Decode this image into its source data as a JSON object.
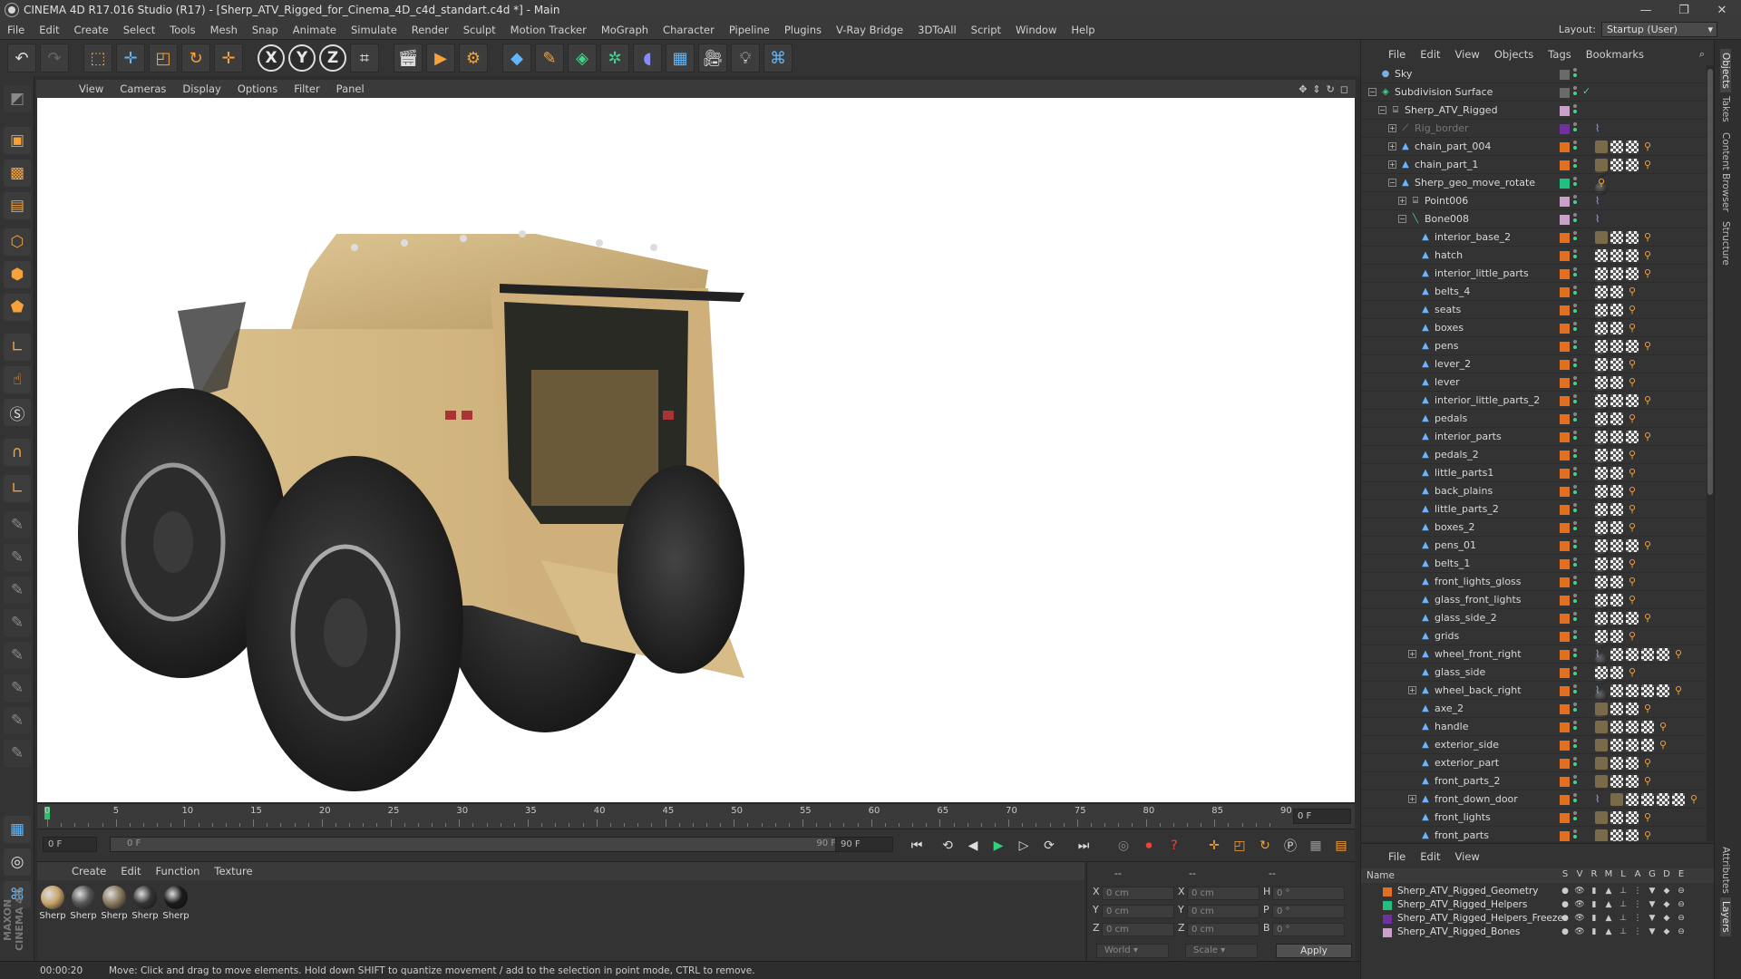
{
  "window": {
    "title": "CINEMA 4D R17.016 Studio (R17) - [Sherp_ATV_Rigged_for_Cinema_4D_c4d_standart.c4d *] - Main",
    "controls": [
      "—",
      "❐",
      "✕"
    ]
  },
  "menubar": {
    "items": [
      "File",
      "Edit",
      "Create",
      "Select",
      "Tools",
      "Mesh",
      "Snap",
      "Animate",
      "Simulate",
      "Render",
      "Sculpt",
      "Motion Tracker",
      "MoGraph",
      "Character",
      "Pipeline",
      "Plugins",
      "V-Ray Bridge",
      "3DToAll",
      "Script",
      "Window",
      "Help"
    ],
    "layout_label": "Layout:",
    "layout_value": "Startup (User)"
  },
  "toolbar": {
    "icons": [
      "undo-icon",
      "redo-icon",
      "live-selection-icon",
      "move-icon",
      "scale-icon",
      "rotate-icon",
      "last-tool-icon",
      "x-axis-icon",
      "y-axis-icon",
      "z-axis-icon",
      "coordinate-system-icon",
      "render-view-icon",
      "render-picture-viewer-icon",
      "edit-render-settings-icon",
      "cube-icon",
      "pen-spline-icon",
      "subdivision-icon",
      "array-icon",
      "deformer-icon",
      "floor-icon",
      "camera-icon",
      "light-icon",
      "python-icon"
    ],
    "axis_labels": [
      "X",
      "Y",
      "Z"
    ]
  },
  "viewport": {
    "menu": [
      "View",
      "Cameras",
      "Display",
      "Options",
      "Filter",
      "Panel"
    ]
  },
  "timeline": {
    "ticks": [
      "0",
      "5",
      "10",
      "15",
      "20",
      "25",
      "30",
      "35",
      "40",
      "45",
      "50",
      "55",
      "60",
      "65",
      "70",
      "75",
      "80",
      "85",
      "90"
    ],
    "current_frame": "0 F"
  },
  "transport": {
    "start_field": "0 F",
    "range_start": "0 F",
    "range_end": "90 F",
    "end_field": "90 F"
  },
  "materials": {
    "menu": [
      "Create",
      "Edit",
      "Function",
      "Texture"
    ],
    "items": [
      {
        "label": "Sherp",
        "color": "#c8a46a"
      },
      {
        "label": "Sherp",
        "color": "#555555"
      },
      {
        "label": "Sherp",
        "color": "#8a7a60"
      },
      {
        "label": "Sherp",
        "color": "#333333"
      },
      {
        "label": "Sherp",
        "color": "#1a1a1a"
      }
    ]
  },
  "coords": {
    "headers": [
      "--",
      "--",
      "--"
    ],
    "rows": [
      {
        "a": "X",
        "av": "0 cm",
        "b": "X",
        "bv": "0 cm",
        "c": "H",
        "cv": "0 °"
      },
      {
        "a": "Y",
        "av": "0 cm",
        "b": "Y",
        "bv": "0 cm",
        "c": "P",
        "cv": "0 °"
      },
      {
        "a": "Z",
        "av": "0 cm",
        "b": "Z",
        "bv": "0 cm",
        "c": "B",
        "cv": "0 °"
      }
    ],
    "mode1": "World",
    "mode2": "Scale",
    "apply": "Apply"
  },
  "status": {
    "time": "00:00:20",
    "message": "Move: Click and drag to move elements. Hold down SHIFT to quantize movement / add to the selection in point mode, CTRL to remove."
  },
  "object_manager": {
    "menu": [
      "File",
      "Edit",
      "View",
      "Objects",
      "Tags",
      "Bookmarks"
    ],
    "objects": [
      {
        "name": "Sky",
        "indent": 0,
        "icon": "sky-icon",
        "exp": "",
        "layer": "",
        "tags": []
      },
      {
        "name": "Subdivision Surface",
        "indent": 0,
        "icon": "subdivision-icon",
        "exp": "−",
        "layer": "",
        "tags": []
      },
      {
        "name": "Sherp_ATV_Rigged",
        "indent": 1,
        "icon": "null-icon",
        "exp": "−",
        "layer": "#c8a0c8",
        "tags": []
      },
      {
        "name": "Rig_border",
        "indent": 2,
        "icon": "spline-icon",
        "exp": "+",
        "layer": "#7030a0",
        "tags": [
          "spl"
        ],
        "dim": true
      },
      {
        "name": "chain_part_004",
        "indent": 2,
        "icon": "joint-icon",
        "exp": "+",
        "layer": "#e07020",
        "tags": [
          "tex",
          "mat",
          "chk",
          "chk",
          "org"
        ]
      },
      {
        "name": "chain_part_1",
        "indent": 2,
        "icon": "joint-icon",
        "exp": "+",
        "layer": "#e07020",
        "tags": [
          "tex",
          "mat",
          "chk",
          "chk",
          "org"
        ]
      },
      {
        "name": "Sherp_geo_move_rotate",
        "indent": 2,
        "icon": "joint-icon",
        "exp": "−",
        "layer": "#20c080",
        "tags": [
          "org"
        ]
      },
      {
        "name": "Point006",
        "indent": 3,
        "icon": "null-icon",
        "exp": "+",
        "layer": "#c8a0c8",
        "tags": [
          "spl"
        ]
      },
      {
        "name": "Bone008",
        "indent": 3,
        "icon": "bone-icon",
        "exp": "−",
        "layer": "#c8a0c8",
        "tags": [
          "spl"
        ]
      },
      {
        "name": "interior_base_2",
        "indent": 4,
        "icon": "joint-icon",
        "exp": "",
        "layer": "#e07020",
        "tags": [
          "tex",
          "chk",
          "chk",
          "org"
        ]
      },
      {
        "name": "hatch",
        "indent": 4,
        "icon": "joint-icon",
        "exp": "",
        "layer": "#e07020",
        "tags": [
          "mat",
          "chk",
          "chk",
          "chk",
          "org"
        ]
      },
      {
        "name": "interior_little_parts",
        "indent": 4,
        "icon": "joint-icon",
        "exp": "",
        "layer": "#e07020",
        "tags": [
          "mat",
          "chk",
          "chk",
          "chk",
          "org"
        ]
      },
      {
        "name": "belts_4",
        "indent": 4,
        "icon": "joint-icon",
        "exp": "",
        "layer": "#e07020",
        "tags": [
          "mat",
          "chk",
          "chk",
          "org"
        ]
      },
      {
        "name": "seats",
        "indent": 4,
        "icon": "joint-icon",
        "exp": "",
        "layer": "#e07020",
        "tags": [
          "mat",
          "chk",
          "chk",
          "org"
        ]
      },
      {
        "name": "boxes",
        "indent": 4,
        "icon": "joint-icon",
        "exp": "",
        "layer": "#e07020",
        "tags": [
          "mat",
          "chk",
          "chk",
          "org"
        ]
      },
      {
        "name": "pens",
        "indent": 4,
        "icon": "joint-icon",
        "exp": "",
        "layer": "#e07020",
        "tags": [
          "mat",
          "chk",
          "chk",
          "chk",
          "org"
        ]
      },
      {
        "name": "lever_2",
        "indent": 4,
        "icon": "joint-icon",
        "exp": "",
        "layer": "#e07020",
        "tags": [
          "mat",
          "chk",
          "chk",
          "org"
        ]
      },
      {
        "name": "lever",
        "indent": 4,
        "icon": "joint-icon",
        "exp": "",
        "layer": "#e07020",
        "tags": [
          "mat",
          "chk",
          "chk",
          "org"
        ]
      },
      {
        "name": "interior_little_parts_2",
        "indent": 4,
        "icon": "joint-icon",
        "exp": "",
        "layer": "#e07020",
        "tags": [
          "mat",
          "chk",
          "chk",
          "chk",
          "org"
        ]
      },
      {
        "name": "pedals",
        "indent": 4,
        "icon": "joint-icon",
        "exp": "",
        "layer": "#e07020",
        "tags": [
          "mat",
          "chk",
          "chk",
          "org"
        ]
      },
      {
        "name": "interior_parts",
        "indent": 4,
        "icon": "joint-icon",
        "exp": "",
        "layer": "#e07020",
        "tags": [
          "mat",
          "chk",
          "chk",
          "chk",
          "org"
        ]
      },
      {
        "name": "pedals_2",
        "indent": 4,
        "icon": "joint-icon",
        "exp": "",
        "layer": "#e07020",
        "tags": [
          "mat",
          "chk",
          "chk",
          "org"
        ]
      },
      {
        "name": "little_parts1",
        "indent": 4,
        "icon": "joint-icon",
        "exp": "",
        "layer": "#e07020",
        "tags": [
          "mat",
          "chk",
          "chk",
          "org"
        ]
      },
      {
        "name": "back_plains",
        "indent": 4,
        "icon": "joint-icon",
        "exp": "",
        "layer": "#e07020",
        "tags": [
          "mat",
          "chk",
          "chk",
          "org"
        ]
      },
      {
        "name": "little_parts_2",
        "indent": 4,
        "icon": "joint-icon",
        "exp": "",
        "layer": "#e07020",
        "tags": [
          "mat",
          "chk",
          "chk",
          "org"
        ]
      },
      {
        "name": "boxes_2",
        "indent": 4,
        "icon": "joint-icon",
        "exp": "",
        "layer": "#e07020",
        "tags": [
          "mat",
          "chk",
          "chk",
          "org"
        ]
      },
      {
        "name": "pens_01",
        "indent": 4,
        "icon": "joint-icon",
        "exp": "",
        "layer": "#e07020",
        "tags": [
          "mat",
          "chk",
          "chk",
          "chk",
          "org"
        ]
      },
      {
        "name": "belts_1",
        "indent": 4,
        "icon": "joint-icon",
        "exp": "",
        "layer": "#e07020",
        "tags": [
          "mat",
          "chk",
          "chk",
          "org"
        ]
      },
      {
        "name": "front_lights_gloss",
        "indent": 4,
        "icon": "joint-icon",
        "exp": "",
        "layer": "#e07020",
        "tags": [
          "mat",
          "chk",
          "chk",
          "org"
        ]
      },
      {
        "name": "glass_front_lights",
        "indent": 4,
        "icon": "joint-icon",
        "exp": "",
        "layer": "#e07020",
        "tags": [
          "mat",
          "chk",
          "chk",
          "org"
        ]
      },
      {
        "name": "glass_side_2",
        "indent": 4,
        "icon": "joint-icon",
        "exp": "",
        "layer": "#e07020",
        "tags": [
          "mat",
          "chk",
          "chk",
          "chk",
          "org"
        ]
      },
      {
        "name": "grids",
        "indent": 4,
        "icon": "joint-icon",
        "exp": "",
        "layer": "#e07020",
        "tags": [
          "mat",
          "chk",
          "chk",
          "org"
        ]
      },
      {
        "name": "wheel_front_right",
        "indent": 4,
        "icon": "joint-icon",
        "exp": "+",
        "layer": "#e07020",
        "tags": [
          "spl",
          "mat",
          "chk",
          "chk",
          "chk",
          "chk",
          "org"
        ]
      },
      {
        "name": "glass_side",
        "indent": 4,
        "icon": "joint-icon",
        "exp": "",
        "layer": "#e07020",
        "tags": [
          "mat",
          "chk",
          "chk",
          "org"
        ]
      },
      {
        "name": "wheel_back_right",
        "indent": 4,
        "icon": "joint-icon",
        "exp": "+",
        "layer": "#e07020",
        "tags": [
          "spl",
          "mat",
          "chk",
          "chk",
          "chk",
          "chk",
          "org"
        ]
      },
      {
        "name": "axe_2",
        "indent": 4,
        "icon": "joint-icon",
        "exp": "",
        "layer": "#e07020",
        "tags": [
          "tex",
          "chk",
          "chk",
          "org"
        ]
      },
      {
        "name": "handle",
        "indent": 4,
        "icon": "joint-icon",
        "exp": "",
        "layer": "#e07020",
        "tags": [
          "tex",
          "chk",
          "chk",
          "chk",
          "org"
        ]
      },
      {
        "name": "exterior_side",
        "indent": 4,
        "icon": "joint-icon",
        "exp": "",
        "layer": "#e07020",
        "tags": [
          "tex",
          "chk",
          "chk",
          "chk",
          "org"
        ]
      },
      {
        "name": "exterior_part",
        "indent": 4,
        "icon": "joint-icon",
        "exp": "",
        "layer": "#e07020",
        "tags": [
          "tex",
          "chk",
          "chk",
          "org"
        ]
      },
      {
        "name": "front_parts_2",
        "indent": 4,
        "icon": "joint-icon",
        "exp": "",
        "layer": "#e07020",
        "tags": [
          "tex",
          "chk",
          "chk",
          "org"
        ]
      },
      {
        "name": "front_down_door",
        "indent": 4,
        "icon": "joint-icon",
        "exp": "+",
        "layer": "#e07020",
        "tags": [
          "spl",
          "tex",
          "chk",
          "chk",
          "chk",
          "chk",
          "org"
        ]
      },
      {
        "name": "front_lights",
        "indent": 4,
        "icon": "joint-icon",
        "exp": "",
        "layer": "#e07020",
        "tags": [
          "tex",
          "chk",
          "chk",
          "org"
        ]
      },
      {
        "name": "front_parts",
        "indent": 4,
        "icon": "joint-icon",
        "exp": "",
        "layer": "#e07020",
        "tags": [
          "tex",
          "chk",
          "chk",
          "org"
        ]
      }
    ]
  },
  "layer_manager": {
    "menu": [
      "File",
      "Edit",
      "View"
    ],
    "header_name": "Name",
    "header_cols": [
      "S",
      "V",
      "R",
      "M",
      "L",
      "A",
      "G",
      "D",
      "E"
    ],
    "layers": [
      {
        "name": "Sherp_ATV_Rigged_Geometry",
        "color": "#e07020"
      },
      {
        "name": "Sherp_ATV_Rigged_Helpers",
        "color": "#20c080"
      },
      {
        "name": "Sherp_ATV_Rigged_Helpers_Freeze",
        "color": "#7030a0"
      },
      {
        "name": "Sherp_ATV_Rigged_Bones",
        "color": "#c8a0c8"
      }
    ]
  },
  "side_tabs": [
    "Objects",
    "Takes",
    "Content Browser",
    "Structure",
    "Attributes",
    "Layers"
  ],
  "maxon_logo": "MAXON CINEMA 4D"
}
